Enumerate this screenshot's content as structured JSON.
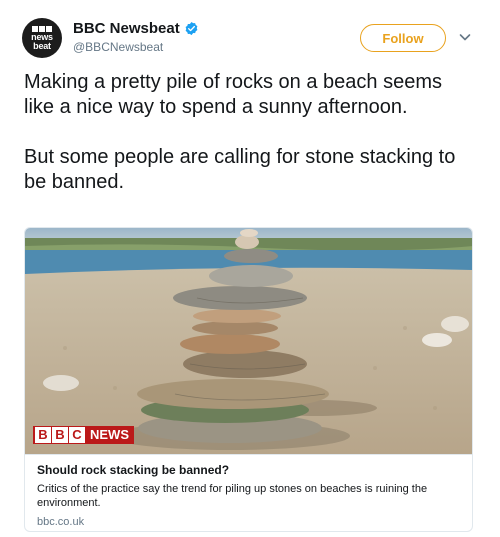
{
  "account": {
    "avatar_lines": [
      "BBC",
      "news",
      "beat"
    ],
    "display_name": "BBC Newsbeat",
    "handle": "@BBCNewsbeat",
    "verified_icon": "verified-badge-icon"
  },
  "follow_button": {
    "label": "Follow",
    "color": "#e9a21e"
  },
  "menu_icon": "chevron-down-icon",
  "tweet": {
    "text": "Making a pretty pile of rocks on a beach seems like a nice way to spend a sunny afternoon.\n\nBut some people are calling for stone stacking to be banned."
  },
  "card": {
    "image_description_icon": "stacked-stones-photo",
    "logo": {
      "letters": [
        "B",
        "B",
        "C"
      ],
      "word": "NEWS",
      "color": "#bb1919"
    },
    "title": "Should rock stacking be banned?",
    "description": "Critics of the practice say the trend for piling up stones on beaches is ruining the environment.",
    "domain": "bbc.co.uk"
  },
  "colors": {
    "text": "#14171a",
    "secondary": "#657786",
    "border": "#e1e8ed",
    "verified": "#1da1f2"
  }
}
